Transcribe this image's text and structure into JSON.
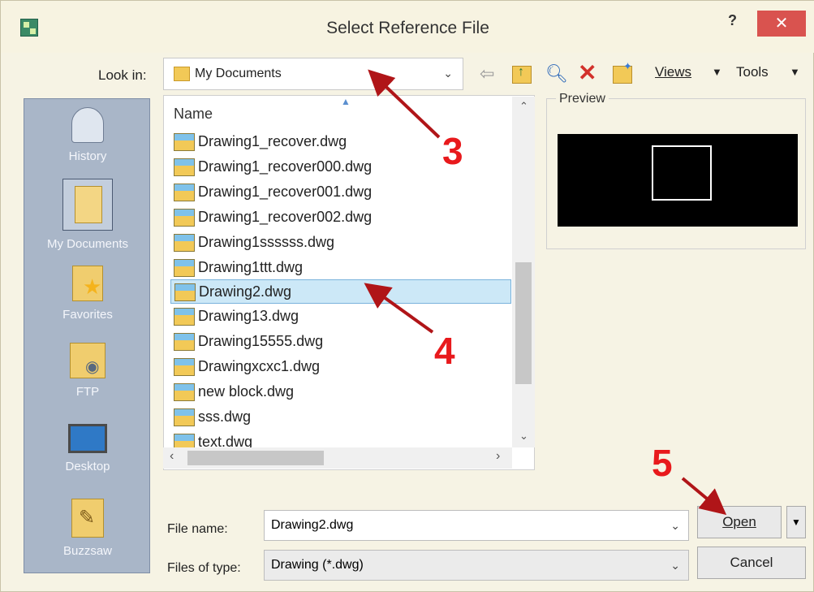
{
  "window": {
    "title": "Select Reference File",
    "help": "?",
    "close": "✕"
  },
  "toolbar": {
    "look_in_label": "Look in:",
    "look_in_value": "My Documents",
    "views_label": "Views",
    "tools_label": "Tools",
    "icons": [
      "back-icon",
      "up-folder-icon",
      "search-icon",
      "delete-icon",
      "new-folder-icon"
    ]
  },
  "places": [
    {
      "label": "History",
      "icon": "history-icon"
    },
    {
      "label": "My Documents",
      "icon": "my-documents-icon"
    },
    {
      "label": "Favorites",
      "icon": "favorites-icon"
    },
    {
      "label": "FTP",
      "icon": "ftp-icon"
    },
    {
      "label": "Desktop",
      "icon": "desktop-icon"
    },
    {
      "label": "Buzzsaw",
      "icon": "buzzsaw-icon"
    }
  ],
  "file_list": {
    "column_header": "Name",
    "files": [
      "Drawing1_recover.dwg",
      "Drawing1_recover000.dwg",
      "Drawing1_recover001.dwg",
      "Drawing1_recover002.dwg",
      "Drawing1ssssss.dwg",
      "Drawing1ttt.dwg",
      "Drawing2.dwg",
      "Drawing13.dwg",
      "Drawing15555.dwg",
      "Drawingxcxc1.dwg",
      "new block.dwg",
      "sss.dwg",
      "text.dwg"
    ],
    "selected_index": 6
  },
  "preview": {
    "label": "Preview"
  },
  "bottom": {
    "file_name_label": "File name:",
    "file_name_value": "Drawing2.dwg",
    "file_type_label": "Files of type:",
    "file_type_value": "Drawing (*.dwg)",
    "open_label": "Open",
    "cancel_label": "Cancel"
  },
  "annotations": [
    "3",
    "4",
    "5"
  ],
  "colors": {
    "annotation": "#e8191c",
    "selection": "#cce8f7",
    "places_bar": "#a9b6c8",
    "close_button": "#d9534f"
  }
}
